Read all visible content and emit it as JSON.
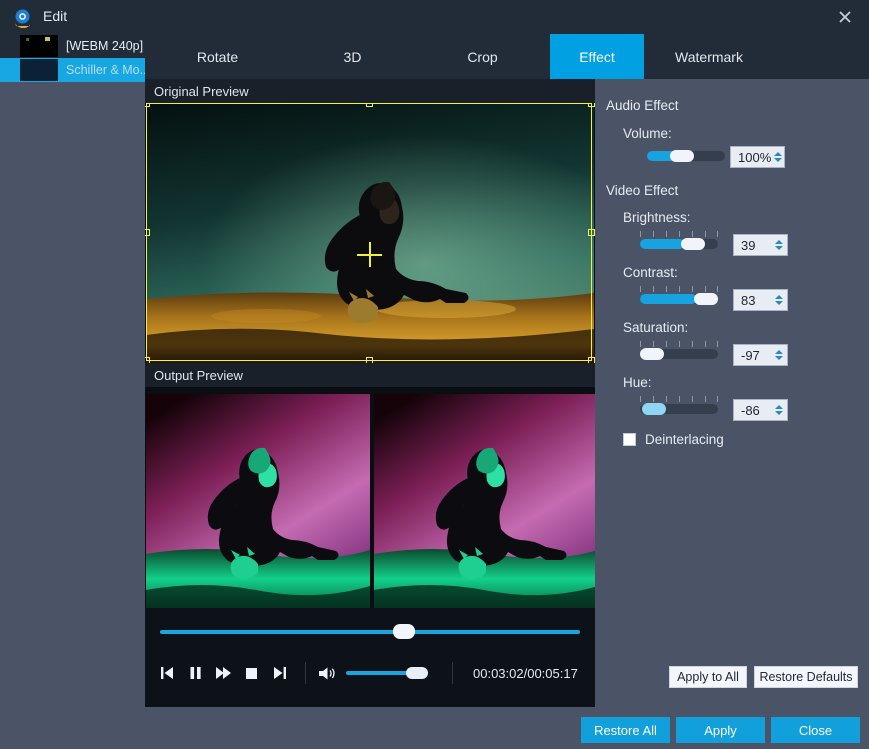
{
  "window": {
    "title": "Edit",
    "logo_icon": "app-logo-icon",
    "close_icon": "close-icon"
  },
  "sidebar": {
    "items": [
      {
        "label": "[WEBM 240p] ..",
        "selected": false
      },
      {
        "label": "Schiller & Mo...",
        "selected": true
      }
    ]
  },
  "tabs": [
    {
      "label": "Rotate",
      "active": false
    },
    {
      "label": "3D",
      "active": false
    },
    {
      "label": "Crop",
      "active": false
    },
    {
      "label": "Effect",
      "active": true
    },
    {
      "label": "Watermark",
      "active": false
    }
  ],
  "preview": {
    "original_label": "Original Preview",
    "output_label": "Output Preview",
    "crosshair_icon": "crosshair-marker-icon"
  },
  "transport": {
    "seek_position_percent": 57,
    "buttons": [
      {
        "name": "previous-frame-button",
        "icon": "skip-previous-icon"
      },
      {
        "name": "pause-button",
        "icon": "pause-icon"
      },
      {
        "name": "fast-forward-button",
        "icon": "fast-forward-icon"
      },
      {
        "name": "stop-button",
        "icon": "stop-icon"
      },
      {
        "name": "next-frame-button",
        "icon": "skip-next-icon"
      }
    ],
    "volume_icon": "speaker-icon",
    "volume_percent": 73,
    "timecode": "00:03:02/00:05:17"
  },
  "effects": {
    "audio_group": "Audio Effect",
    "video_group": "Video Effect",
    "volume": {
      "label": "Volume:",
      "value": "100%",
      "fill_percent": 38,
      "thumb_percent": 38,
      "ticks": false
    },
    "brightness": {
      "label": "Brightness:",
      "value": "39",
      "fill_percent": 57,
      "thumb_percent": 53,
      "ticks": true
    },
    "contrast": {
      "label": "Contrast:",
      "value": "83",
      "fill_percent": 73,
      "thumb_percent": 70,
      "ticks": true
    },
    "saturation": {
      "label": "Saturation:",
      "value": "-97",
      "fill_percent": 0,
      "thumb_percent": 1,
      "ticks": true
    },
    "hue": {
      "label": "Hue:",
      "value": "-86",
      "fill_percent": 0,
      "thumb_percent": 4,
      "ticks": true
    },
    "deinterlacing": {
      "label": "Deinterlacing",
      "checked": false
    },
    "apply_to_all": "Apply to All",
    "restore_defaults": "Restore Defaults"
  },
  "footer": {
    "restore_all": "Restore All",
    "apply": "Apply",
    "close": "Close"
  },
  "colors": {
    "accent": "#00a0e3",
    "panel": "#4b5466",
    "titlebar": "#222b38",
    "crop_outline": "#f4f04a"
  }
}
